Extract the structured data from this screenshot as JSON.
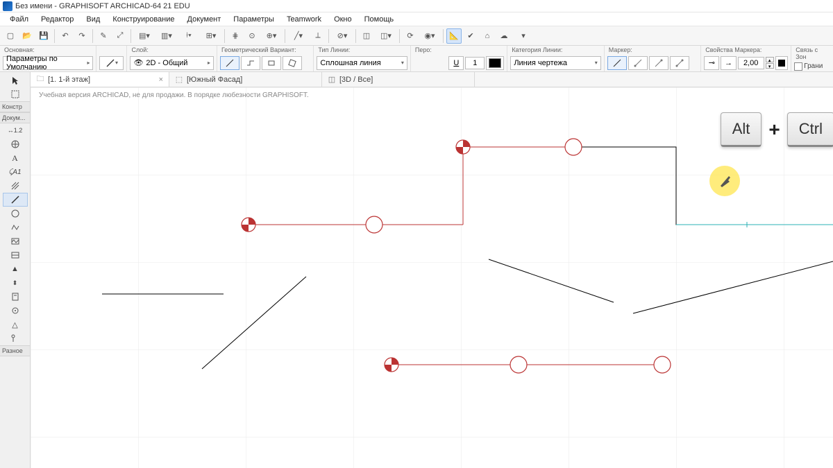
{
  "title": "Без имени - GRAPHISOFT ARCHICAD-64 21 EDU",
  "menu": [
    "Файл",
    "Редактор",
    "Вид",
    "Конструирование",
    "Документ",
    "Параметры",
    "Teamwork",
    "Окно",
    "Помощь"
  ],
  "options": {
    "basic_label": "Основная:",
    "basic_value": "Параметры по Умолчанию",
    "layer_label": "Слой:",
    "layer_value": "2D - Общий",
    "geom_label": "Геометрический Вариант:",
    "linetype_label": "Тип Линии:",
    "linetype_value": "Сплошная линия",
    "pen_label": "Перо:",
    "pen_value": "1",
    "linecat_label": "Категория Линии:",
    "linecat_value": "Линия чертежа",
    "marker_label": "Маркер:",
    "markerprops_label": "Свойства Маркера:",
    "marker_size": "2,00",
    "relation_label": "Связь с Зон",
    "boundary_label": "Грани"
  },
  "tabs": [
    {
      "label": "[1. 1-й этаж]",
      "active": true,
      "closable": true
    },
    {
      "label": "[Южный Фасад]",
      "active": false,
      "closable": false
    },
    {
      "label": "[3D / Все]",
      "active": false,
      "closable": false
    }
  ],
  "sidebar": {
    "group_constr": "Констр",
    "group_doc": "Докум...",
    "group_misc": "Разное"
  },
  "watermark": "Учебная версия ARCHICAD, не для продажи. В порядке любезности GRAPHISOFT.",
  "keys": {
    "a": "Alt",
    "b": "Ctrl",
    "sep": "+"
  }
}
